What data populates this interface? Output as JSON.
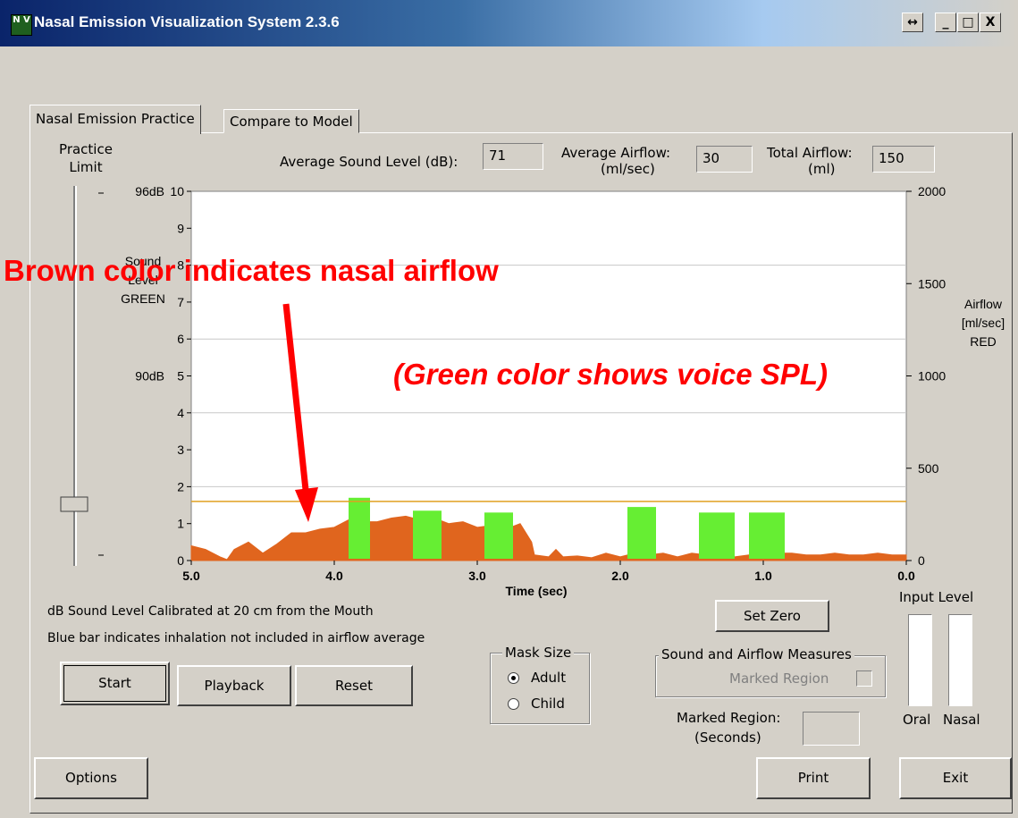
{
  "window": {
    "title": "Nasal Emission Visualization System 2.3.6",
    "icon_text": "N V",
    "restore_icon": "↔",
    "minimize_icon": "_",
    "maximize_icon": "□",
    "close_icon": "X"
  },
  "tabs": [
    {
      "label": "Nasal Emission Practice",
      "active": true
    },
    {
      "label": "Compare to Model",
      "active": false
    }
  ],
  "practice_limit": {
    "label_line1": "Practice",
    "label_line2": "Limit",
    "slider_value_fraction": 0.16
  },
  "measures": {
    "avg_sound_label": "Average Sound Level (dB):",
    "avg_sound_value": "71",
    "avg_airflow_label1": "Average Airflow:",
    "avg_airflow_label2": "(ml/sec)",
    "avg_airflow_value": "30",
    "total_airflow_label1": "Total Airflow:",
    "total_airflow_label2": "(ml)",
    "total_airflow_value": "150"
  },
  "chart_data": {
    "type": "area",
    "left_axis": {
      "label_lines": [
        "Sound",
        "Level",
        "GREEN"
      ],
      "ticks": [
        "0",
        "1",
        "2",
        "3",
        "4",
        "5",
        "6",
        "7",
        "8",
        "9",
        "10"
      ],
      "range": [
        0,
        10
      ],
      "db_markers": [
        "96dB",
        "90dB"
      ]
    },
    "right_axis": {
      "label_lines": [
        "Airflow",
        "[ml/sec]",
        "RED"
      ],
      "ticks": [
        "0",
        "500",
        "1000",
        "1500",
        "2000"
      ],
      "range": [
        0,
        2000
      ]
    },
    "x_axis": {
      "label": "Time (sec)",
      "ticks": [
        "5.0",
        "4.0",
        "3.0",
        "2.0",
        "1.0",
        "0.0"
      ],
      "range": [
        5.0,
        0.0
      ]
    },
    "gridlines_y": [
      2,
      4,
      6,
      8
    ],
    "threshold_line": 1.6,
    "green_series": {
      "name": "Sound Level",
      "color": "#66ee33",
      "segments": [
        {
          "x": [
            3.9,
            3.75
          ],
          "y": 1.7
        },
        {
          "x": [
            3.45,
            3.25
          ],
          "y": 1.35
        },
        {
          "x": [
            2.95,
            2.75
          ],
          "y": 1.3
        },
        {
          "x": [
            1.95,
            1.75
          ],
          "y": 1.45
        },
        {
          "x": [
            1.45,
            1.2
          ],
          "y": 1.3
        },
        {
          "x": [
            1.1,
            0.85
          ],
          "y": 1.3
        }
      ]
    },
    "brown_series": {
      "name": "Nasal Airflow",
      "color": "#e0651e",
      "x": [
        5.0,
        4.9,
        4.8,
        4.75,
        4.7,
        4.6,
        4.5,
        4.4,
        4.3,
        4.2,
        4.1,
        4.0,
        3.9,
        3.8,
        3.7,
        3.6,
        3.5,
        3.4,
        3.3,
        3.2,
        3.1,
        3.0,
        2.9,
        2.8,
        2.7,
        2.62,
        2.6,
        2.5,
        2.45,
        2.4,
        2.3,
        2.2,
        2.1,
        2.0,
        1.9,
        1.8,
        1.7,
        1.6,
        1.5,
        1.4,
        1.3,
        1.2,
        1.1,
        1.0,
        0.9,
        0.8,
        0.7,
        0.6,
        0.5,
        0.4,
        0.3,
        0.2,
        0.1,
        0.0
      ],
      "y": [
        80,
        60,
        20,
        5,
        60,
        100,
        40,
        90,
        150,
        150,
        170,
        180,
        220,
        210,
        210,
        230,
        240,
        220,
        230,
        200,
        210,
        180,
        190,
        170,
        200,
        100,
        30,
        20,
        60,
        20,
        25,
        15,
        40,
        20,
        40,
        30,
        40,
        20,
        40,
        30,
        30,
        20,
        30,
        30,
        40,
        40,
        30,
        30,
        40,
        30,
        30,
        40,
        30,
        30
      ]
    }
  },
  "annotations": {
    "brown": "Brown color indicates nasal airflow",
    "green": "(Green color shows voice SPL)"
  },
  "notes": {
    "calibration": "dB Sound Level Calibrated at 20 cm from the Mouth",
    "blue_bar": "Blue bar indicates inhalation not included in airflow average"
  },
  "buttons": {
    "start": "Start",
    "playback": "Playback",
    "reset": "Reset",
    "set_zero": "Set Zero",
    "options": "Options",
    "print": "Print",
    "exit": "Exit"
  },
  "mask_size": {
    "title": "Mask Size",
    "options": [
      "Adult",
      "Child"
    ],
    "selected": "Adult"
  },
  "sound_airflow": {
    "title": "Sound and Airflow Measures",
    "marked_region_label": "Marked Region",
    "checked": false
  },
  "marked_region": {
    "label1": "Marked Region:",
    "label2": "(Seconds)",
    "value": ""
  },
  "input_level": {
    "title": "Input Level",
    "oral": "Oral",
    "nasal": "Nasal"
  }
}
